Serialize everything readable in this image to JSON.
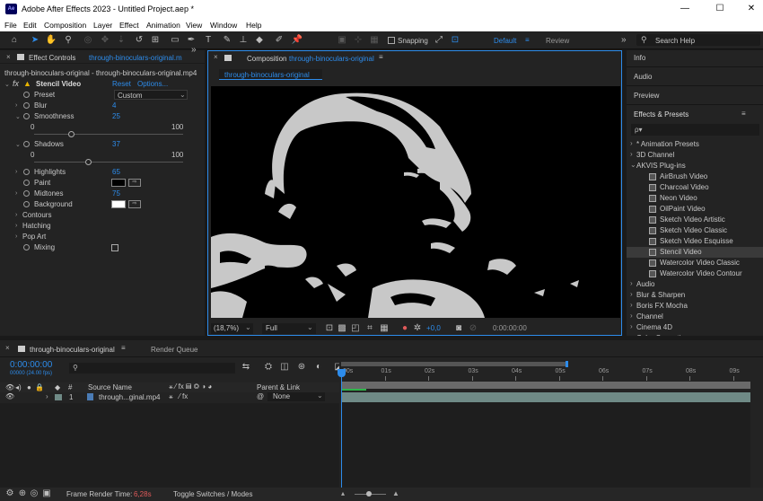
{
  "app": {
    "title": "Adobe After Effects 2023 - Untitled Project.aep *",
    "icon_text": "Ae"
  },
  "window_controls": {
    "minimize": "—",
    "maximize": "☐",
    "close": "✕"
  },
  "menu": [
    "File",
    "Edit",
    "Composition",
    "Layer",
    "Effect",
    "Animation",
    "View",
    "Window",
    "Help"
  ],
  "toolbar": {
    "snapping_label": "Snapping",
    "workspaces": {
      "active": "Default",
      "other": "Review"
    },
    "search_help": "Search Help"
  },
  "effect_controls": {
    "tab_prefix": "Effect Controls",
    "tab_layer": "through-binoculars-original.m",
    "subheader": "through-binoculars-original - through-binoculars-original.mp4",
    "effect": {
      "fx": "fx",
      "name": "Stencil Video",
      "reset": "Reset",
      "options": "Options..."
    },
    "props": {
      "preset": {
        "label": "Preset",
        "value": "Custom"
      },
      "blur": {
        "label": "Blur",
        "value": "4"
      },
      "smoothness": {
        "label": "Smoothness",
        "value": "25",
        "min": "0",
        "max": "100",
        "level": 0.25
      },
      "shadows": {
        "label": "Shadows",
        "value": "37",
        "min": "0",
        "max": "100",
        "level": 0.37
      },
      "highlights": {
        "label": "Highlights",
        "value": "65"
      },
      "paint": {
        "label": "Paint",
        "color": "#000000"
      },
      "midtones": {
        "label": "Midtones",
        "value": "75"
      },
      "background": {
        "label": "Background",
        "color": "#ffffff"
      },
      "contours": {
        "label": "Contours"
      },
      "hatching": {
        "label": "Hatching"
      },
      "pop_art": {
        "label": "Pop Art"
      },
      "mixing": {
        "label": "Mixing"
      }
    }
  },
  "composition": {
    "tab_prefix": "Composition",
    "tab_name": "through-binoculars-original",
    "subtab": "through-binoculars-original",
    "zoom": "(18,7%)",
    "resolution": "Full",
    "exposure": "+0,0",
    "timecode": "0:00:00:00"
  },
  "right_panels": {
    "info": "Info",
    "audio": "Audio",
    "preview": "Preview",
    "effects_presets": "Effects & Presets",
    "search_icon_label": "ρ▾",
    "tree": [
      {
        "label": "* Animation Presets",
        "type": "folder"
      },
      {
        "label": "3D Channel",
        "type": "folder"
      },
      {
        "label": "AKVIS Plug-ins",
        "type": "open"
      },
      {
        "label": "AirBrush Video",
        "type": "item"
      },
      {
        "label": "Charcoal Video",
        "type": "item"
      },
      {
        "label": "Neon Video",
        "type": "item"
      },
      {
        "label": "OilPaint Video",
        "type": "item"
      },
      {
        "label": "Sketch Video Artistic",
        "type": "item"
      },
      {
        "label": "Sketch Video Classic",
        "type": "item"
      },
      {
        "label": "Sketch Video Esquisse",
        "type": "item"
      },
      {
        "label": "Stencil Video",
        "type": "item-selected"
      },
      {
        "label": "Watercolor Video Classic",
        "type": "item"
      },
      {
        "label": "Watercolor Video Contour",
        "type": "item"
      },
      {
        "label": "Audio",
        "type": "folder"
      },
      {
        "label": "Blur & Sharpen",
        "type": "folder"
      },
      {
        "label": "Boris FX Mocha",
        "type": "folder"
      },
      {
        "label": "Channel",
        "type": "folder"
      },
      {
        "label": "Cinema 4D",
        "type": "folder"
      },
      {
        "label": "Color Correction",
        "type": "folder"
      }
    ]
  },
  "timeline": {
    "tab": "through-binoculars-original",
    "render_queue": "Render Queue",
    "timecode": "0:00:00:00",
    "fps": "00000 (24.00 fps)",
    "columns": {
      "num": "#",
      "source": "Source Name",
      "parent": "Parent & Link"
    },
    "layer": {
      "num": "1",
      "name": "through...ginal.mp4",
      "parent": "None"
    },
    "ruler": [
      "00s",
      "01s",
      "02s",
      "03s",
      "04s",
      "05s",
      "06s",
      "07s",
      "08s",
      "09s"
    ],
    "footer": {
      "frame_render_label": "Frame Render Time:",
      "frame_render_value": "6,28s",
      "toggle": "Toggle Switches / Modes"
    }
  },
  "colors": {
    "accent": "#2d8ceb",
    "warning": "#e8b400",
    "render_time": "#e05a5a",
    "layer_bar": "#6f8a86"
  }
}
